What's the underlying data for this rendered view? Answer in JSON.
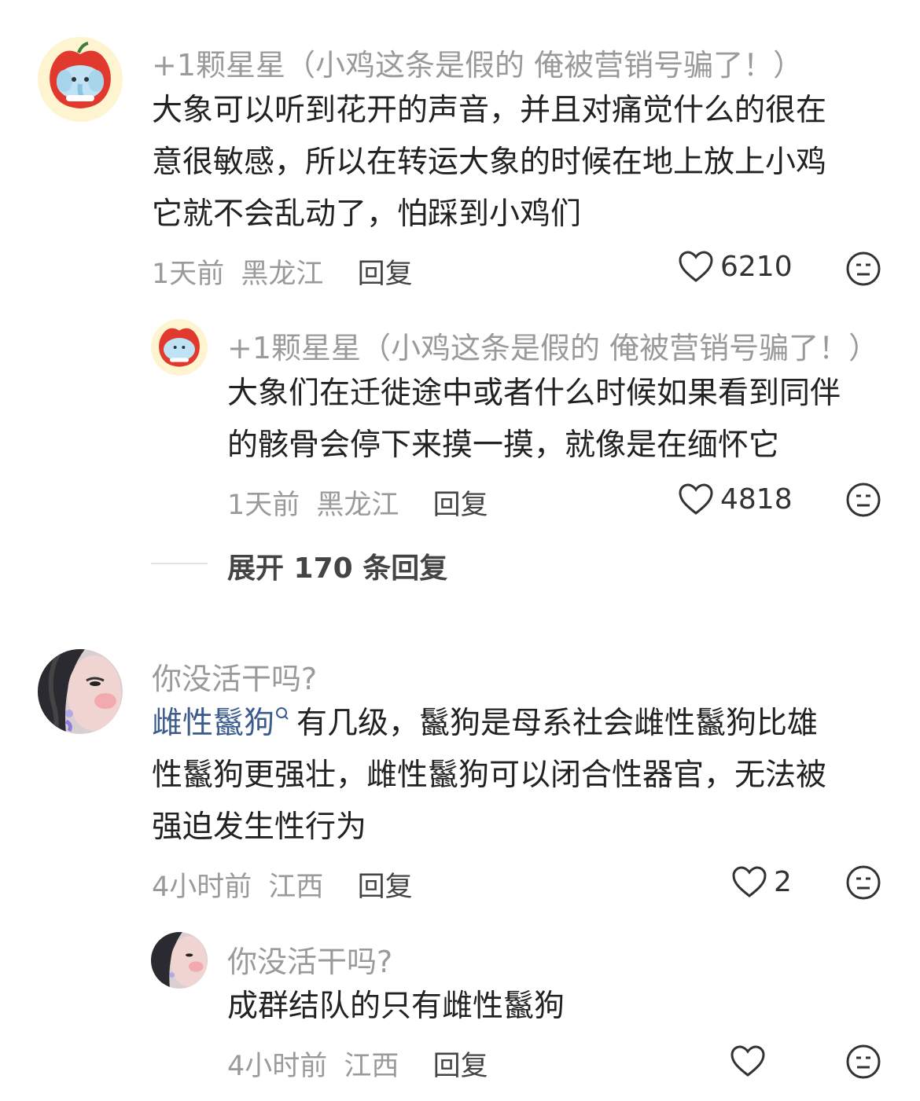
{
  "comments": [
    {
      "user": "+1颗星星（小鸡这条是假的 俺被营销号骗了！）",
      "lines": [
        "大象可以听到花开的声音，并且对痛觉什么的很在",
        "意很敏感，所以在转运大象的时候在地上放上小鸡",
        "它就不会乱动了，怕踩到小鸡们"
      ],
      "time": "1天前",
      "location": "黑龙江",
      "reply_label": "回复",
      "likes": "6210",
      "avatar_icon": "apple-elephant-avatar-icon"
    },
    {
      "user": "+1颗星星（小鸡这条是假的 俺被营销号骗了！）",
      "lines": [
        "大象们在迁徙途中或者什么时候如果看到同伴",
        "的骸骨会停下来摸一摸，就像是在缅怀它"
      ],
      "time": "1天前",
      "location": "黑龙江",
      "reply_label": "回复",
      "likes": "4818",
      "avatar_icon": "apple-elephant-avatar-icon"
    },
    {
      "user": "你没活干吗?",
      "mention": "雌性鬣狗",
      "mention_icon": "search-icon",
      "lines": [
        "有几级，鬣狗是母系社会雌性鬣狗比雄",
        "性鬣狗更强壮，雌性鬣狗可以闭合性器官，无法被",
        "强迫发生性行为"
      ],
      "time": "4小时前",
      "location": "江西",
      "reply_label": "回复",
      "likes": "2",
      "avatar_icon": "girl-photo-avatar-icon"
    },
    {
      "user": "你没活干吗?",
      "lines": [
        "成群结队的只有雌性鬣狗"
      ],
      "time": "4小时前",
      "location": "江西",
      "reply_label": "回复",
      "likes": "",
      "avatar_icon": "girl-photo-avatar-icon"
    }
  ],
  "expand_replies": "展开 170 条回复",
  "colors": {
    "accent_mention": "#3b5b8c",
    "meta": "#9a9a9a",
    "text": "#222222"
  }
}
